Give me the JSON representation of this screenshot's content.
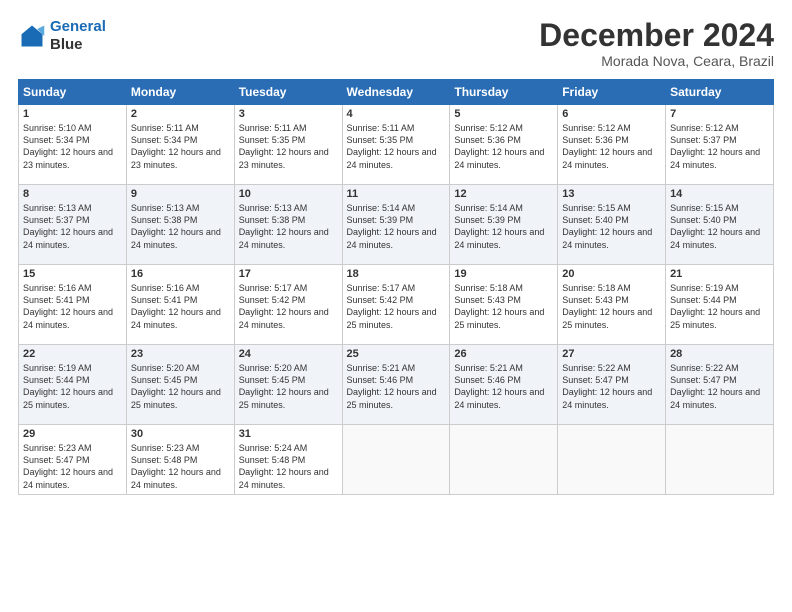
{
  "header": {
    "logo_line1": "General",
    "logo_line2": "Blue",
    "month_title": "December 2024",
    "subtitle": "Morada Nova, Ceara, Brazil"
  },
  "weekdays": [
    "Sunday",
    "Monday",
    "Tuesday",
    "Wednesday",
    "Thursday",
    "Friday",
    "Saturday"
  ],
  "weeks": [
    [
      {
        "day": "1",
        "sunrise": "5:10 AM",
        "sunset": "5:34 PM",
        "daylight": "12 hours and 23 minutes."
      },
      {
        "day": "2",
        "sunrise": "5:11 AM",
        "sunset": "5:34 PM",
        "daylight": "12 hours and 23 minutes."
      },
      {
        "day": "3",
        "sunrise": "5:11 AM",
        "sunset": "5:35 PM",
        "daylight": "12 hours and 23 minutes."
      },
      {
        "day": "4",
        "sunrise": "5:11 AM",
        "sunset": "5:35 PM",
        "daylight": "12 hours and 24 minutes."
      },
      {
        "day": "5",
        "sunrise": "5:12 AM",
        "sunset": "5:36 PM",
        "daylight": "12 hours and 24 minutes."
      },
      {
        "day": "6",
        "sunrise": "5:12 AM",
        "sunset": "5:36 PM",
        "daylight": "12 hours and 24 minutes."
      },
      {
        "day": "7",
        "sunrise": "5:12 AM",
        "sunset": "5:37 PM",
        "daylight": "12 hours and 24 minutes."
      }
    ],
    [
      {
        "day": "8",
        "sunrise": "5:13 AM",
        "sunset": "5:37 PM",
        "daylight": "12 hours and 24 minutes."
      },
      {
        "day": "9",
        "sunrise": "5:13 AM",
        "sunset": "5:38 PM",
        "daylight": "12 hours and 24 minutes."
      },
      {
        "day": "10",
        "sunrise": "5:13 AM",
        "sunset": "5:38 PM",
        "daylight": "12 hours and 24 minutes."
      },
      {
        "day": "11",
        "sunrise": "5:14 AM",
        "sunset": "5:39 PM",
        "daylight": "12 hours and 24 minutes."
      },
      {
        "day": "12",
        "sunrise": "5:14 AM",
        "sunset": "5:39 PM",
        "daylight": "12 hours and 24 minutes."
      },
      {
        "day": "13",
        "sunrise": "5:15 AM",
        "sunset": "5:40 PM",
        "daylight": "12 hours and 24 minutes."
      },
      {
        "day": "14",
        "sunrise": "5:15 AM",
        "sunset": "5:40 PM",
        "daylight": "12 hours and 24 minutes."
      }
    ],
    [
      {
        "day": "15",
        "sunrise": "5:16 AM",
        "sunset": "5:41 PM",
        "daylight": "12 hours and 24 minutes."
      },
      {
        "day": "16",
        "sunrise": "5:16 AM",
        "sunset": "5:41 PM",
        "daylight": "12 hours and 24 minutes."
      },
      {
        "day": "17",
        "sunrise": "5:17 AM",
        "sunset": "5:42 PM",
        "daylight": "12 hours and 24 minutes."
      },
      {
        "day": "18",
        "sunrise": "5:17 AM",
        "sunset": "5:42 PM",
        "daylight": "12 hours and 25 minutes."
      },
      {
        "day": "19",
        "sunrise": "5:18 AM",
        "sunset": "5:43 PM",
        "daylight": "12 hours and 25 minutes."
      },
      {
        "day": "20",
        "sunrise": "5:18 AM",
        "sunset": "5:43 PM",
        "daylight": "12 hours and 25 minutes."
      },
      {
        "day": "21",
        "sunrise": "5:19 AM",
        "sunset": "5:44 PM",
        "daylight": "12 hours and 25 minutes."
      }
    ],
    [
      {
        "day": "22",
        "sunrise": "5:19 AM",
        "sunset": "5:44 PM",
        "daylight": "12 hours and 25 minutes."
      },
      {
        "day": "23",
        "sunrise": "5:20 AM",
        "sunset": "5:45 PM",
        "daylight": "12 hours and 25 minutes."
      },
      {
        "day": "24",
        "sunrise": "5:20 AM",
        "sunset": "5:45 PM",
        "daylight": "12 hours and 25 minutes."
      },
      {
        "day": "25",
        "sunrise": "5:21 AM",
        "sunset": "5:46 PM",
        "daylight": "12 hours and 25 minutes."
      },
      {
        "day": "26",
        "sunrise": "5:21 AM",
        "sunset": "5:46 PM",
        "daylight": "12 hours and 24 minutes."
      },
      {
        "day": "27",
        "sunrise": "5:22 AM",
        "sunset": "5:47 PM",
        "daylight": "12 hours and 24 minutes."
      },
      {
        "day": "28",
        "sunrise": "5:22 AM",
        "sunset": "5:47 PM",
        "daylight": "12 hours and 24 minutes."
      }
    ],
    [
      {
        "day": "29",
        "sunrise": "5:23 AM",
        "sunset": "5:47 PM",
        "daylight": "12 hours and 24 minutes."
      },
      {
        "day": "30",
        "sunrise": "5:23 AM",
        "sunset": "5:48 PM",
        "daylight": "12 hours and 24 minutes."
      },
      {
        "day": "31",
        "sunrise": "5:24 AM",
        "sunset": "5:48 PM",
        "daylight": "12 hours and 24 minutes."
      },
      null,
      null,
      null,
      null
    ]
  ]
}
